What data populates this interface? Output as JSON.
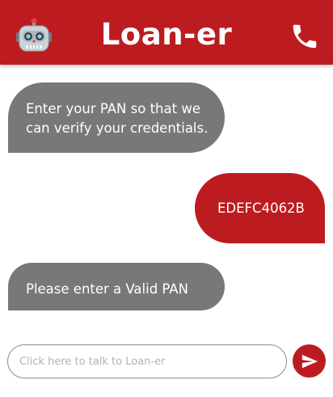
{
  "header": {
    "brand": "Loan-er",
    "avatar_icon": "robot-icon",
    "call_icon": "phone-icon",
    "background_color": "#bc1c20"
  },
  "messages": [
    {
      "sender": "bot",
      "text": "Enter your PAN so that we can verify your credentials."
    },
    {
      "sender": "user",
      "text": "EDEFC4062B"
    },
    {
      "sender": "bot",
      "text": "Please enter a Valid PAN"
    }
  ],
  "composer": {
    "placeholder": "Click here to talk to Loan-er",
    "value": "",
    "send_icon": "send-icon"
  },
  "colors": {
    "accent": "#bc1c20",
    "bot_bubble": "#787878",
    "bubble_text": "#ffffff"
  }
}
